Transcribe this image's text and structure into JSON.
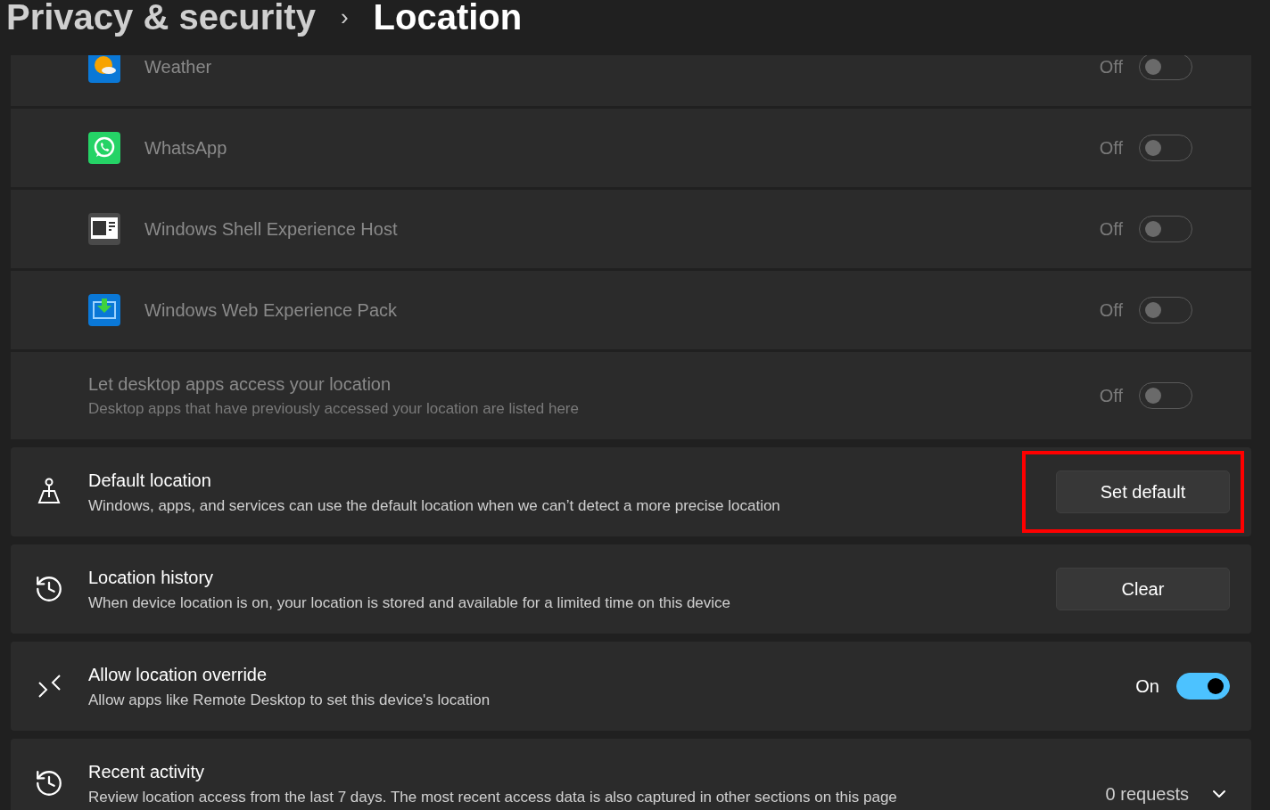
{
  "breadcrumb": {
    "parent": "Privacy & security",
    "separator": "›",
    "current": "Location"
  },
  "apps": [
    {
      "name": "Weather",
      "state_label": "Off",
      "on": false,
      "disabled": true
    },
    {
      "name": "WhatsApp",
      "state_label": "Off",
      "on": false,
      "disabled": true
    },
    {
      "name": "Windows Shell Experience Host",
      "state_label": "Off",
      "on": false,
      "disabled": true
    },
    {
      "name": "Windows Web Experience Pack",
      "state_label": "Off",
      "on": false,
      "disabled": true
    }
  ],
  "desktop_apps": {
    "title": "Let desktop apps access your location",
    "description": "Desktop apps that have previously accessed your location are listed here",
    "state_label": "Off",
    "on": false,
    "disabled": true
  },
  "settings": [
    {
      "kind": "button",
      "title": "Default location",
      "description": "Windows, apps, and services can use the default location when we can’t detect a more precise location",
      "button": "Set default",
      "highlighted": true
    },
    {
      "kind": "button",
      "title": "Location history",
      "description": "When device location is on, your location is stored and available for a limited time on this device",
      "button": "Clear",
      "highlighted": false
    },
    {
      "kind": "toggle",
      "title": "Allow location override",
      "description": "Allow apps like Remote Desktop to set this device's location",
      "state_label": "On",
      "on": true
    },
    {
      "kind": "expander",
      "title": "Recent activity",
      "description": "Review location access from the last 7 days. The most recent access data is also captured in other sections on this page",
      "value": "0 requests",
      "expanded": false
    }
  ]
}
